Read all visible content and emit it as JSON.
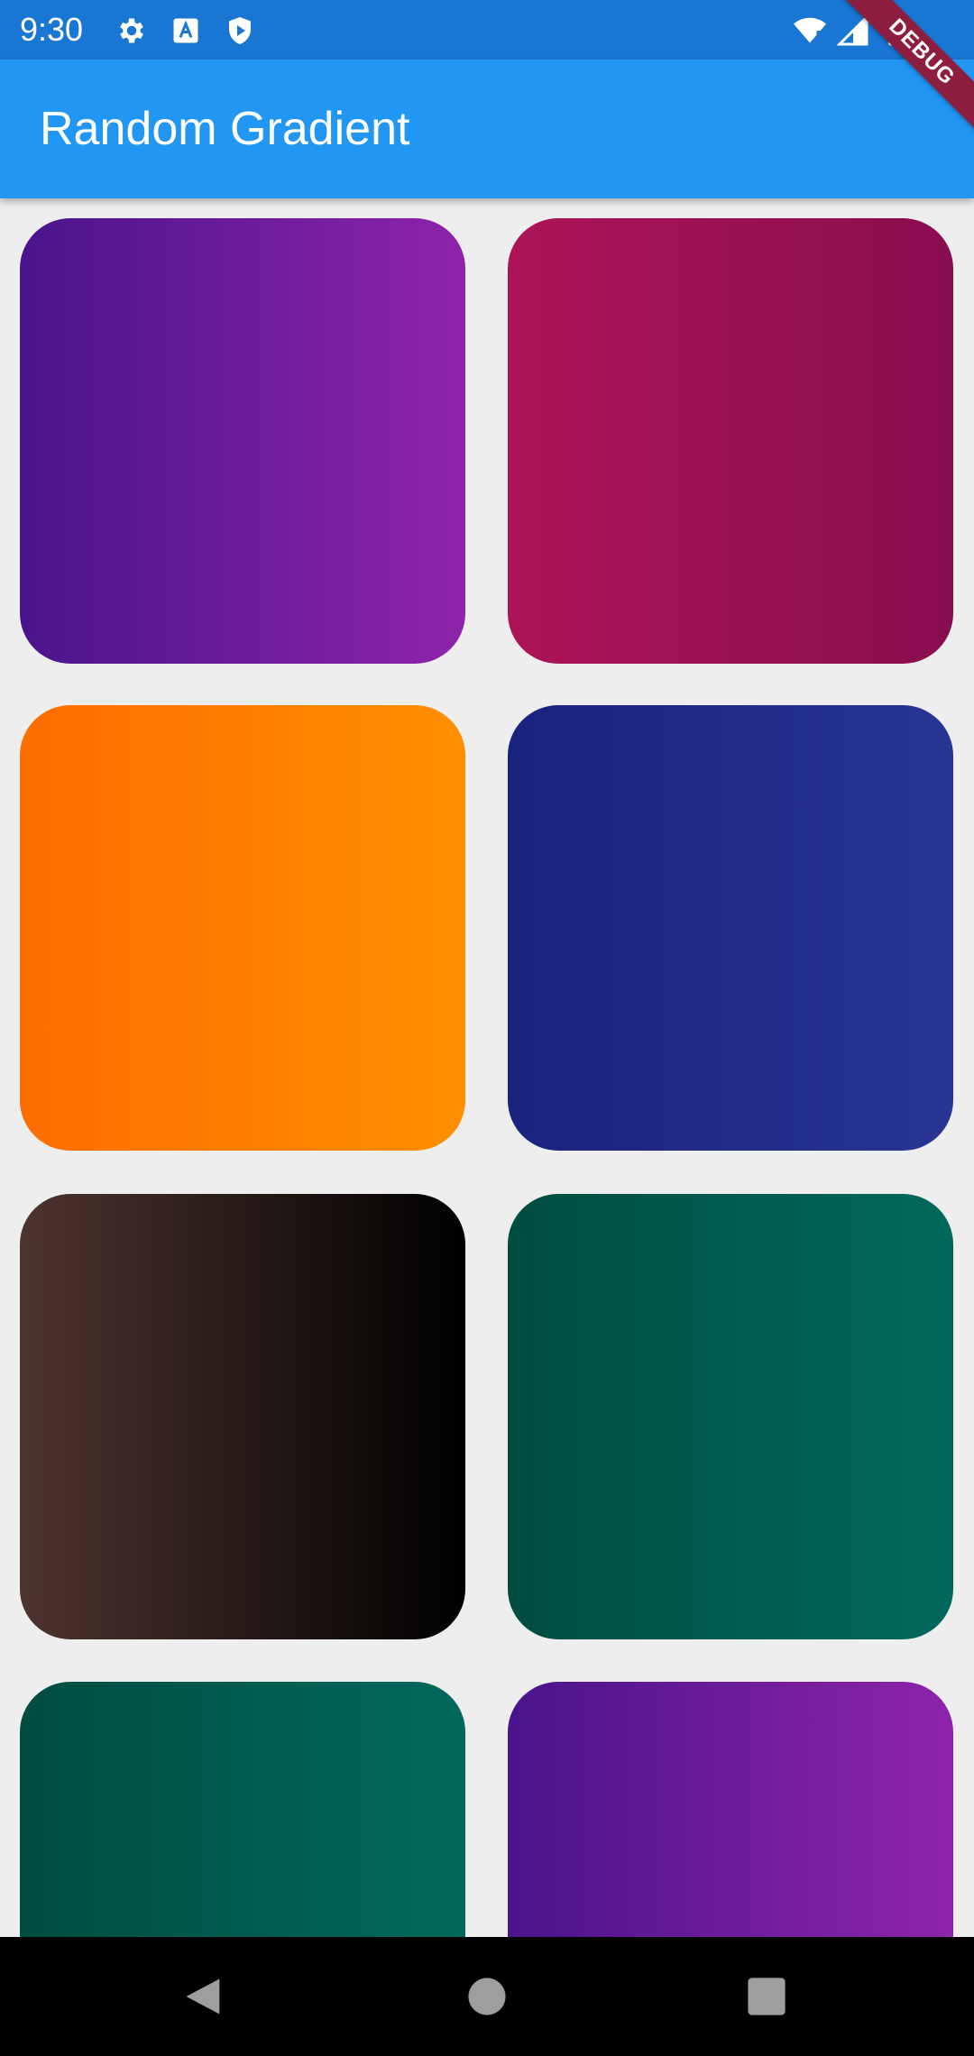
{
  "status_bar": {
    "time": "9:30",
    "left_icons": [
      "gear-icon",
      "text-a-icon",
      "play-shield-icon"
    ],
    "right_icons": [
      "wifi-icon",
      "signal-icon",
      "battery-icon"
    ]
  },
  "debug_banner": {
    "label": "DEBUG"
  },
  "app_bar": {
    "title": "Random Gradient"
  },
  "tiles": [
    {
      "from": "#4a148c",
      "to": "#8e24aa"
    },
    {
      "from": "#ad1457",
      "to": "#880e4f"
    },
    {
      "from": "#ff6d00",
      "to": "#ff8f00"
    },
    {
      "from": "#1a237e",
      "to": "#283593"
    },
    {
      "from": "#4e342e",
      "to": "#000000"
    },
    {
      "from": "#004d40",
      "to": "#00695c"
    },
    {
      "from": "#004d40",
      "to": "#00695c"
    },
    {
      "from": "#4a148c",
      "to": "#8e24aa"
    }
  ],
  "nav_bar": {
    "buttons": [
      "back-icon",
      "home-icon",
      "recents-icon"
    ]
  }
}
